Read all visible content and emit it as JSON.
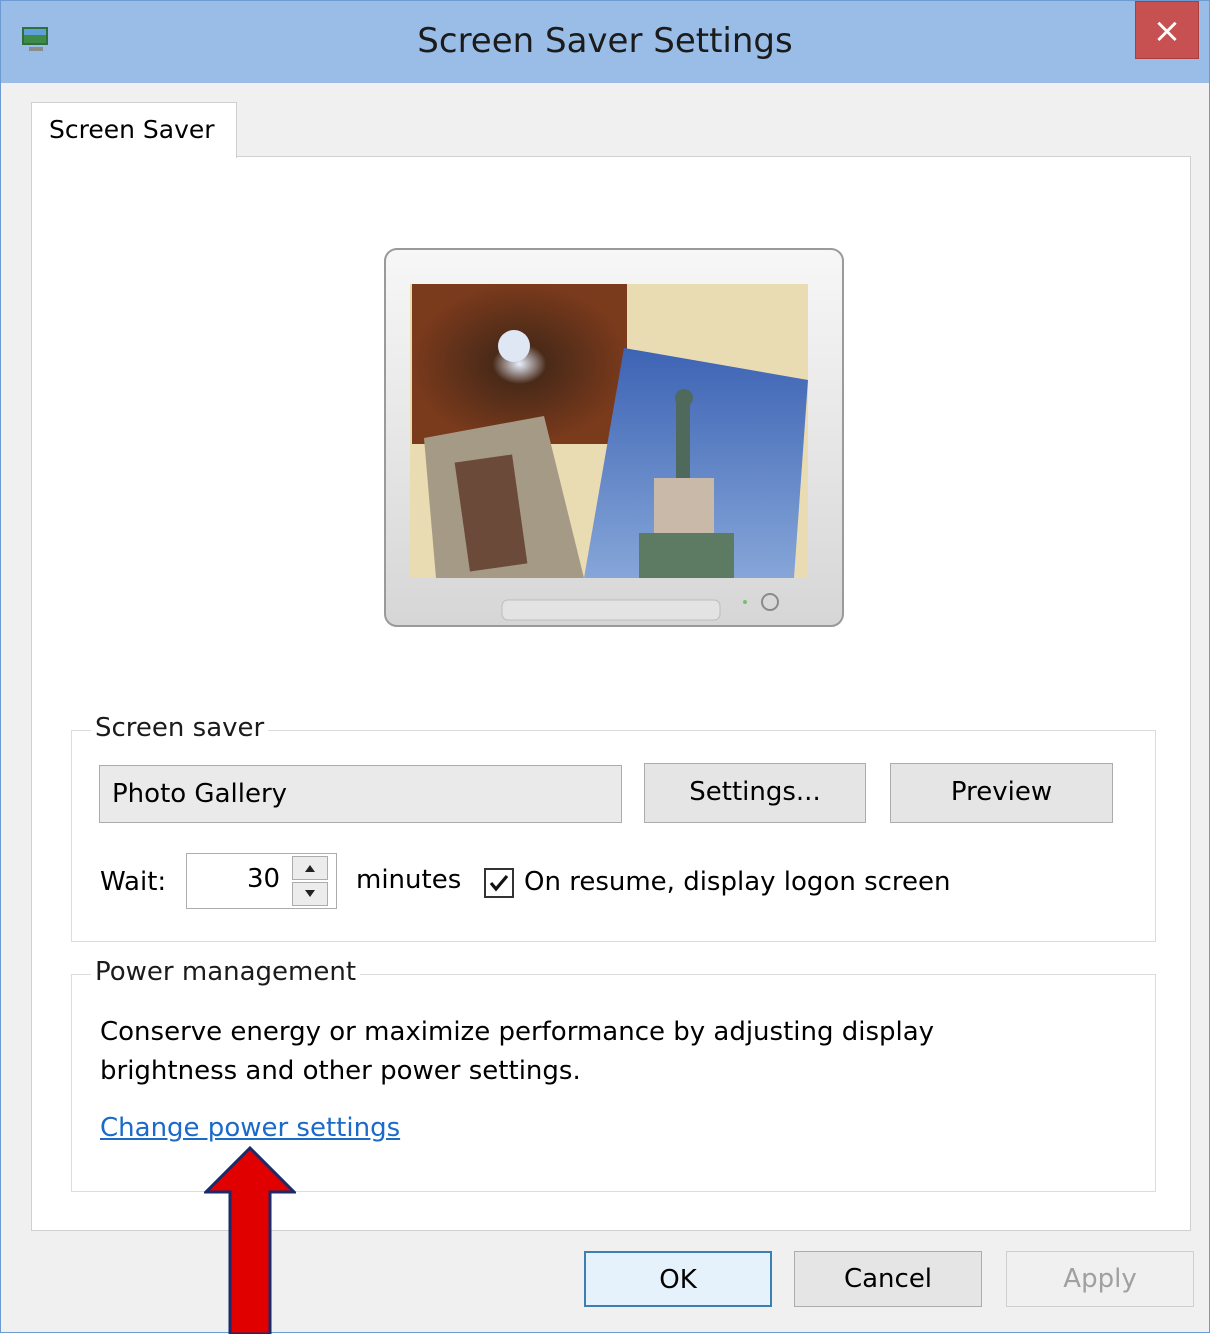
{
  "window": {
    "title": "Screen Saver Settings",
    "close_label": "×"
  },
  "tabs": [
    {
      "label": "Screen Saver"
    }
  ],
  "screen_saver_group": {
    "legend": "Screen saver",
    "selected": "Photo Gallery",
    "settings_label": "Settings...",
    "preview_label": "Preview",
    "wait_label": "Wait:",
    "wait_value": "30",
    "minutes_label": "minutes",
    "resume_checked": true,
    "resume_label": "On resume, display logon screen"
  },
  "power_group": {
    "legend": "Power management",
    "description": "Conserve energy or maximize performance by adjusting display brightness and other power settings.",
    "link_label": "Change power settings"
  },
  "footer": {
    "ok_label": "OK",
    "cancel_label": "Cancel",
    "apply_label": "Apply"
  },
  "annotation": {
    "arrow_color": "#e00000"
  },
  "colors": {
    "titlebar": "#99bde6",
    "close": "#c75050",
    "link": "#1b6ac9"
  }
}
